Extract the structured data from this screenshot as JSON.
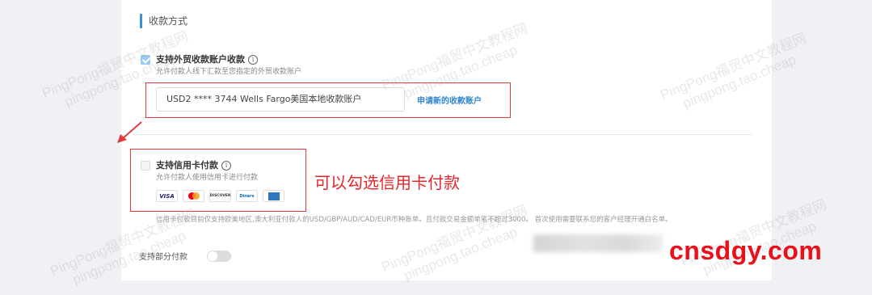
{
  "section": {
    "title": "收款方式"
  },
  "option_foreign": {
    "label": "支持外贸收款账户收款",
    "description": "允许付款人线下汇款至您指定的外贸收款账户",
    "account_value": "USD2  **** 3744  Wells Fargo美国本地收款账户",
    "apply_link": "申请新的收款账户",
    "checked": true
  },
  "option_card": {
    "label": "支持信用卡付款",
    "description": "允许付款人使用信用卡进行付款",
    "checked": false,
    "card_brands": [
      "visa-icon",
      "mastercard-icon",
      "discover-icon",
      "diners-icon",
      "amex-icon"
    ],
    "visa_text": "VISA",
    "discover_text": "DISCOVER",
    "diners_text": "Diners",
    "notice": "信用卡付款目前仅支持欧美地区,澳大利亚付款人的USD/GBP/AUD/CAD/EUR币种账单。且付款交易金额单笔不超过3000。 首次使用需要联系您的客户经理开通白名单。"
  },
  "annotation": "可以勾选信用卡付款",
  "partial": {
    "label": "支持部分付款",
    "enabled": false
  },
  "watermarks": {
    "line1": "PingPong福贸中文教程网",
    "line2": "pingpong.tao.cheap"
  },
  "site_watermark": "cnsdgy.com",
  "colors": {
    "accent": "#3b8fd6",
    "annotation": "#e8252a",
    "link": "#2f86d0"
  }
}
